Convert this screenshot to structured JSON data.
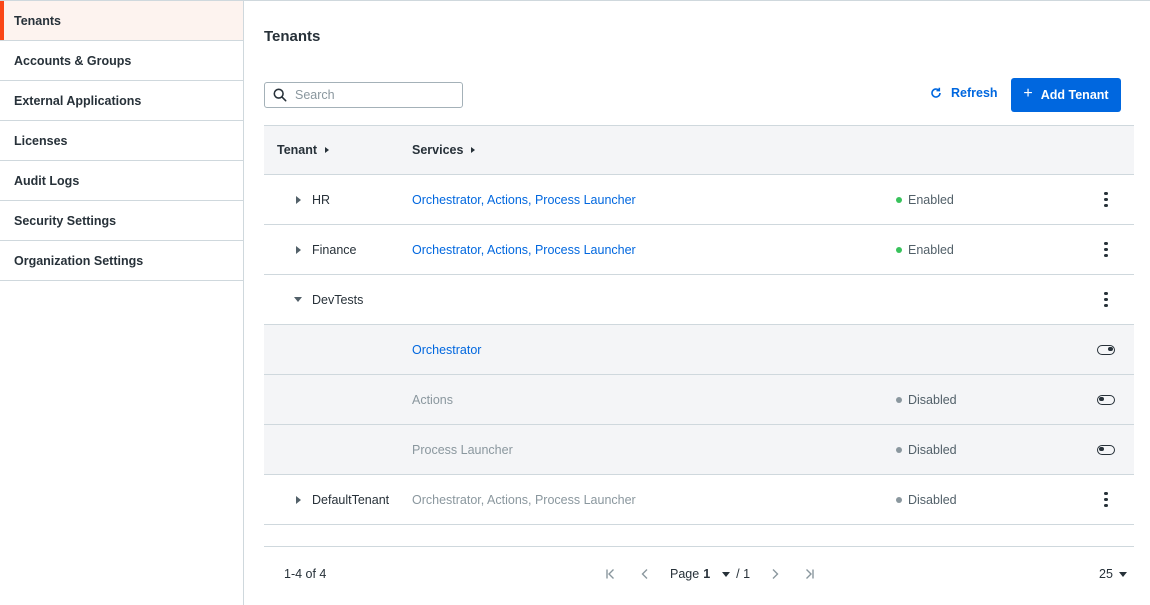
{
  "sidebar": {
    "items": [
      {
        "label": "Tenants",
        "active": true
      },
      {
        "label": "Accounts & Groups"
      },
      {
        "label": "External Applications"
      },
      {
        "label": "Licenses"
      },
      {
        "label": "Audit Logs"
      },
      {
        "label": "Security Settings"
      },
      {
        "label": "Organization Settings"
      }
    ]
  },
  "main": {
    "title": "Tenants",
    "search": {
      "placeholder": "Search",
      "value": ""
    },
    "refresh_label": "Refresh",
    "add_label": "Add Tenant",
    "table": {
      "columns": [
        "Tenant",
        "Services"
      ],
      "rows": [
        {
          "tenant": "HR",
          "services": "Orchestrator, Actions, Process Launcher",
          "status": "Enabled",
          "expanded": false
        },
        {
          "tenant": "Finance",
          "services": "Orchestrator, Actions, Process Launcher",
          "status": "Enabled",
          "expanded": false
        },
        {
          "tenant": "DevTests",
          "services": "",
          "status": "",
          "expanded": true,
          "children": [
            {
              "service": "Orchestrator",
              "status": "",
              "toggle": "on"
            },
            {
              "service": "Actions",
              "status": "Disabled",
              "toggle": "off"
            },
            {
              "service": "Process Launcher",
              "status": "Disabled",
              "toggle": "off"
            }
          ]
        },
        {
          "tenant": "DefaultTenant",
          "services": "Orchestrator, Actions, Process Launcher",
          "status": "Disabled",
          "expanded": false
        }
      ]
    },
    "footer": {
      "range": "1-4 of 4",
      "page_label": "Page",
      "page_value": "1",
      "page_total": "/ 1",
      "per_page": "25"
    }
  },
  "colors": {
    "accent": "#fa4616",
    "primary": "#0067df",
    "enabled": "#38c25c",
    "disabled": "#8a979e"
  }
}
